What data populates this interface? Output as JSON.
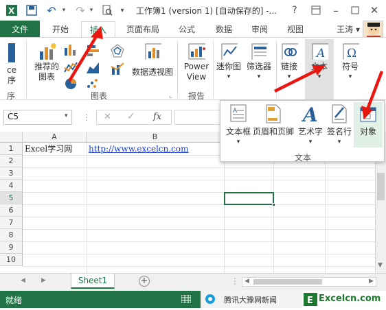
{
  "titlebar": {
    "title": "工作簿1 (version 1) [自动保存的] -...",
    "help": "?"
  },
  "tabs": {
    "file": "文件",
    "home": "开始",
    "insert": "插入",
    "page_layout": "页面布局",
    "formulas": "公式",
    "data": "数据",
    "review": "审阅",
    "view": "视图",
    "user": "王涛"
  },
  "ribbon": {
    "apps_label_1": "ce",
    "apps_label_2": "序",
    "apps_group": "序",
    "recommended_charts": "推荐的",
    "recommended_charts_2": "图表",
    "pivot_chart": "数据透视图",
    "charts_group": "图表",
    "power_view_1": "Power",
    "power_view_2": "View",
    "reports_group": "报告",
    "sparklines": "迷你图",
    "slicer": "筛选器",
    "link": "链接",
    "text": "文本",
    "symbol": "符号"
  },
  "formula_bar": {
    "name_box": "C5",
    "fx": "fx"
  },
  "grid": {
    "columns": [
      "A",
      "B"
    ],
    "rows": [
      "1",
      "2",
      "3",
      "4",
      "5",
      "6",
      "7",
      "8",
      "9",
      "10"
    ],
    "a1": "Excel学习网",
    "b1": "http://www.excelcn.com"
  },
  "text_panel": {
    "textbox": "文本框",
    "header_footer": "页眉和页脚",
    "wordart": "艺术字",
    "signature": "签名行",
    "object": "对象",
    "group": "文本"
  },
  "sheets": {
    "active": "Sheet1"
  },
  "status": {
    "ready": "就绪",
    "news": "腾讯大豫网新闻",
    "watermark": "Excelcn.com"
  },
  "colors": {
    "excel_green": "#217346",
    "arrow_red": "#e8170f"
  }
}
